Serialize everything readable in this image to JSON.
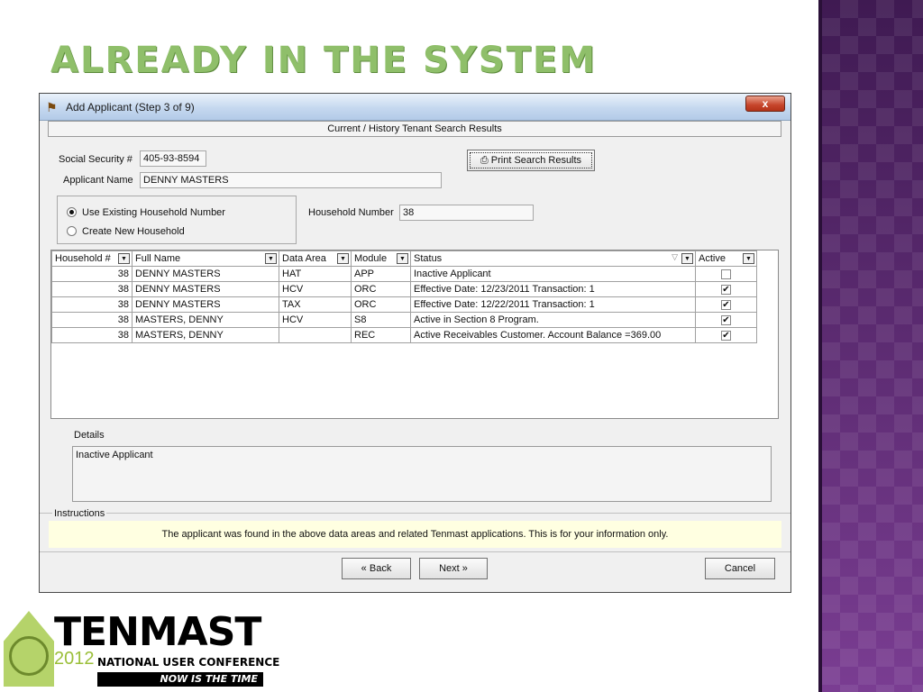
{
  "slide": {
    "title": "ALREADY IN THE SYSTEM",
    "colors": {
      "title": "#8fbf6a",
      "side_panel": "#5a2a6e"
    }
  },
  "window": {
    "title": "Add Applicant (Step 3 of 9)",
    "close_label": "x",
    "section_header": "Current / History Tenant Search Results",
    "ssn_label": "Social Security #",
    "ssn_value": "405-93-8594",
    "applicant_name_label": "Applicant Name",
    "applicant_name_value": "DENNY MASTERS",
    "print_button": "Print Search Results",
    "radio_use_existing": "Use Existing Household Number",
    "radio_create_new": "Create New Household",
    "household_number_label": "Household Number",
    "household_number_value": "38"
  },
  "grid": {
    "columns": [
      "Household #",
      "Full Name",
      "Data Area",
      "Module",
      "Status",
      "Active"
    ],
    "rows": [
      {
        "household": "38",
        "name": "DENNY MASTERS",
        "area": "HAT",
        "module": "APP",
        "status": "Inactive Applicant",
        "active": false
      },
      {
        "household": "38",
        "name": "DENNY MASTERS",
        "area": "HCV",
        "module": "ORC",
        "status": "Effective Date: 12/23/2011 Transaction: 1",
        "active": true
      },
      {
        "household": "38",
        "name": "DENNY MASTERS",
        "area": "TAX",
        "module": "ORC",
        "status": "Effective Date: 12/22/2011 Transaction: 1",
        "active": true
      },
      {
        "household": "38",
        "name": "MASTERS, DENNY",
        "area": "HCV",
        "module": "S8",
        "status": "Active in Section 8 Program.",
        "active": true
      },
      {
        "household": "38",
        "name": "MASTERS, DENNY",
        "area": "",
        "module": "REC",
        "status": "Active Receivables Customer. Account Balance =369.00",
        "active": true
      }
    ]
  },
  "details": {
    "label": "Details",
    "text": "Inactive Applicant"
  },
  "instructions": {
    "label": "Instructions",
    "text": "The applicant was found in the above data areas and related Tenmast applications.  This is for your information only."
  },
  "buttons": {
    "back": "Back",
    "next": "Next",
    "cancel": "Cancel"
  },
  "logo": {
    "word": "TENMAST",
    "year": "2012",
    "subtitle": "NATIONAL USER CONFERENCE",
    "tagline": "NOW IS THE TIME"
  }
}
